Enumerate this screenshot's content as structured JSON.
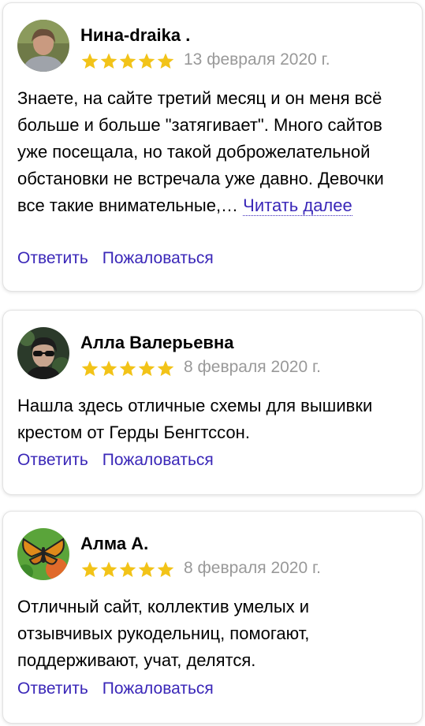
{
  "colors": {
    "link": "#3a27b8",
    "date": "#999999",
    "star": "#f2c318",
    "card_border": "#e2e2e2"
  },
  "reviews": [
    {
      "author": "Нина-draika .",
      "rating": 5,
      "date": "13 февраля 2020 г.",
      "text": "Знаете, на сайте третий месяц и он меня всё больше и больше \"затягивает\". Много сайтов уже посещала, но такой доброжелательной обстановки не встречала уже давно. Девочки все такие внимательные,… ",
      "more_label": "Читать далее",
      "reply_label": "Ответить",
      "report_label": "Пожаловаться"
    },
    {
      "author": "Алла Валерьевна",
      "rating": 5,
      "date": "8 февраля 2020 г.",
      "text": "Нашла здесь отличные схемы для вышивки крестом от Герды Бенгтссон.",
      "reply_label": "Ответить",
      "report_label": "Пожаловаться"
    },
    {
      "author": "Алма А.",
      "rating": 5,
      "date": "8 февраля 2020 г.",
      "text": "Отличный сайт, коллектив умелых и отзывчивых рукодельниц, помогают, поддерживают, учат, делятся.",
      "reply_label": "Ответить",
      "report_label": "Пожаловаться"
    }
  ]
}
